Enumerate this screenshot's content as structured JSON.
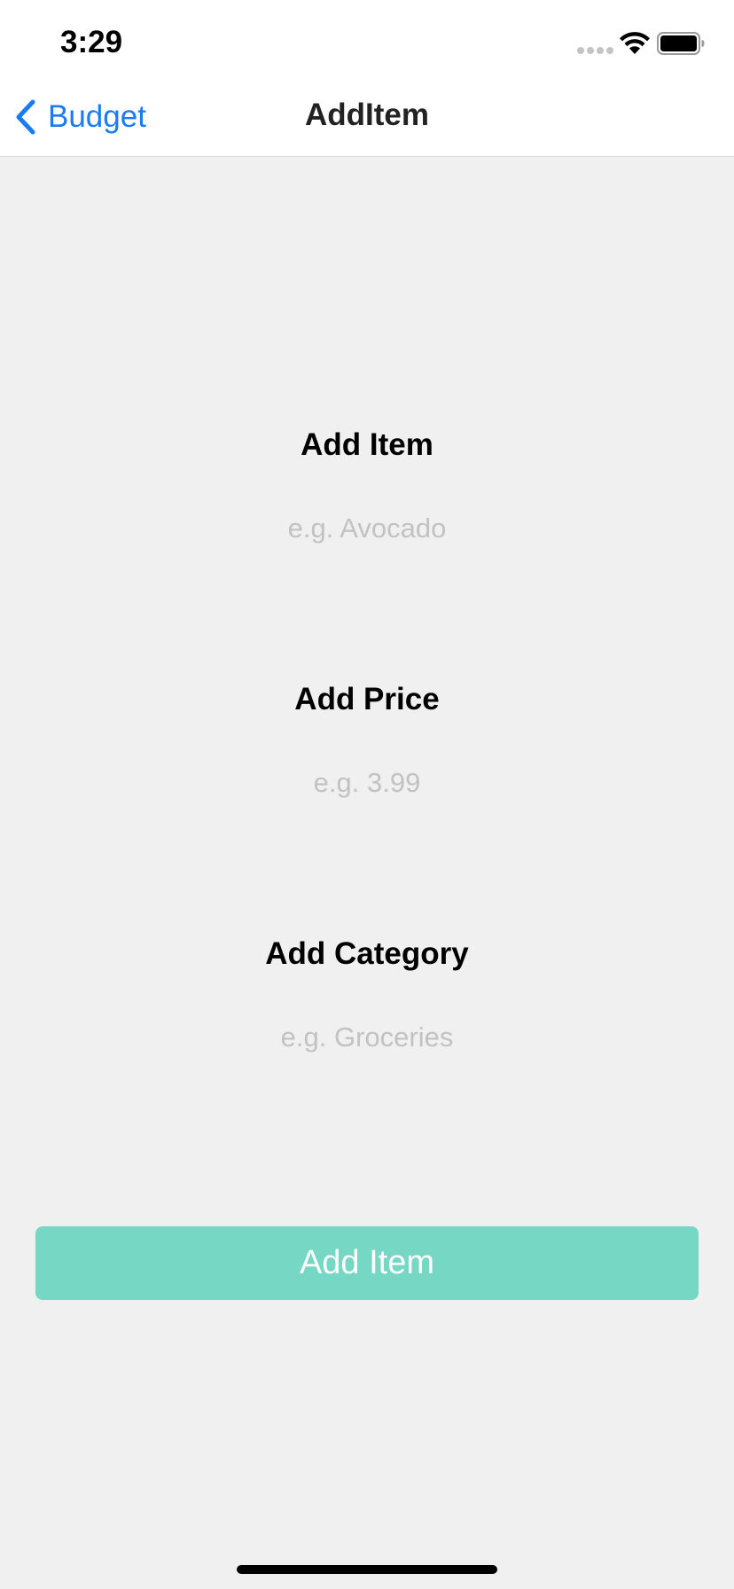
{
  "status_bar": {
    "time": "3:29",
    "icons": [
      "signal-dots-icon",
      "wifi-icon",
      "battery-icon"
    ]
  },
  "nav": {
    "back_label": "Budget",
    "back_icon": "chevron-left-icon",
    "title": "AddItem"
  },
  "form": {
    "item_label": "Add Item",
    "item_placeholder": "e.g. Avocado",
    "price_label": "Add Price",
    "price_placeholder": "e.g. 3.99",
    "category_label": "Add Category",
    "category_placeholder": "e.g. Groceries"
  },
  "submit_label": "Add Item",
  "colors": {
    "accent": "#1a7cf2",
    "button": "#76d7c4",
    "background": "#f0f0f0",
    "placeholder": "#c2c2c2"
  }
}
